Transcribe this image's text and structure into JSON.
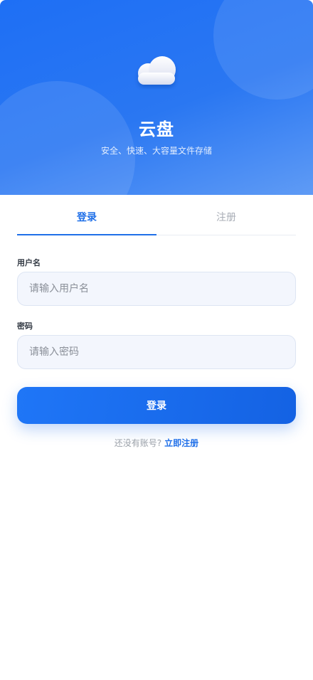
{
  "header": {
    "title": "云盘",
    "subtitle": "安全、快速、大容量文件存储",
    "logo_icon": "cloud-icon"
  },
  "tabs": [
    {
      "label": "登录",
      "active": true
    },
    {
      "label": "注册",
      "active": false
    }
  ],
  "form": {
    "username_label": "用户名",
    "username_placeholder": "请输入用户名",
    "password_label": "密码",
    "password_placeholder": "请输入密码",
    "submit_label": "登录"
  },
  "footer": {
    "prompt": "还没有账号?",
    "register_link": "立即注册"
  },
  "colors": {
    "primary": "#1f6fe8",
    "hero_start": "#1e6ff5",
    "hero_end": "#5f9bf5",
    "input_bg": "#f3f6fd"
  }
}
